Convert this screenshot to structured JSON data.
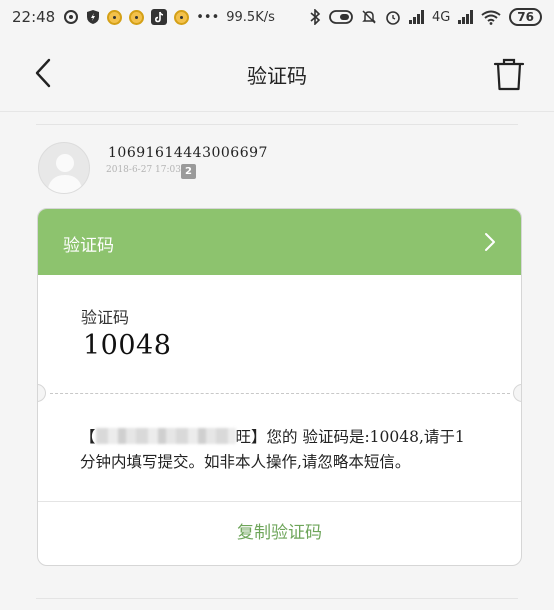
{
  "status_bar": {
    "time": "22:48",
    "dots": "•••",
    "net_speed": "99.5K/s",
    "network": "4G",
    "battery": "76"
  },
  "nav": {
    "title": "验证码"
  },
  "sender": {
    "number": "10691614443006697",
    "date": "2018-6-27 17:03",
    "sim_badge": "2"
  },
  "card": {
    "header_title": "验证码",
    "code_label": "验证码",
    "code_value": "10048",
    "message_line1_open": "【",
    "message_line1_after": "旺】您的 验证码是:10048,请于1",
    "message_line2": "分钟内填写提交。如非本人操作,请忽略本短信。",
    "copy_button": "复制验证码",
    "accent_color": "#8dc36e",
    "copy_color": "#6ea55a"
  }
}
